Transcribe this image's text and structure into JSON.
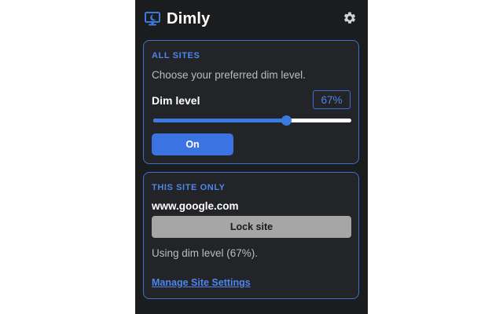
{
  "header": {
    "title": "Dimly",
    "logo_icon": "monitor-moon-icon",
    "settings_icon": "gear-icon"
  },
  "all_sites": {
    "heading": "ALL SITES",
    "description": "Choose your preferred dim level.",
    "dim_label": "Dim level",
    "dim_value": "67%",
    "slider_level_percent": 67,
    "toggle_label": "On"
  },
  "this_site": {
    "heading": "THIS SITE ONLY",
    "domain": "www.google.com",
    "lock_label": "Lock site",
    "status": "Using dim level (67%).",
    "manage_link": "Manage Site Settings"
  },
  "colors": {
    "background": "#1b1c1e",
    "card_background": "#232427",
    "accent": "#3b74e2",
    "accent_text": "#4d86ea",
    "border": "#3b6fd4",
    "slider_track": "#ffffff",
    "lock_button": "#a6a6a6"
  }
}
